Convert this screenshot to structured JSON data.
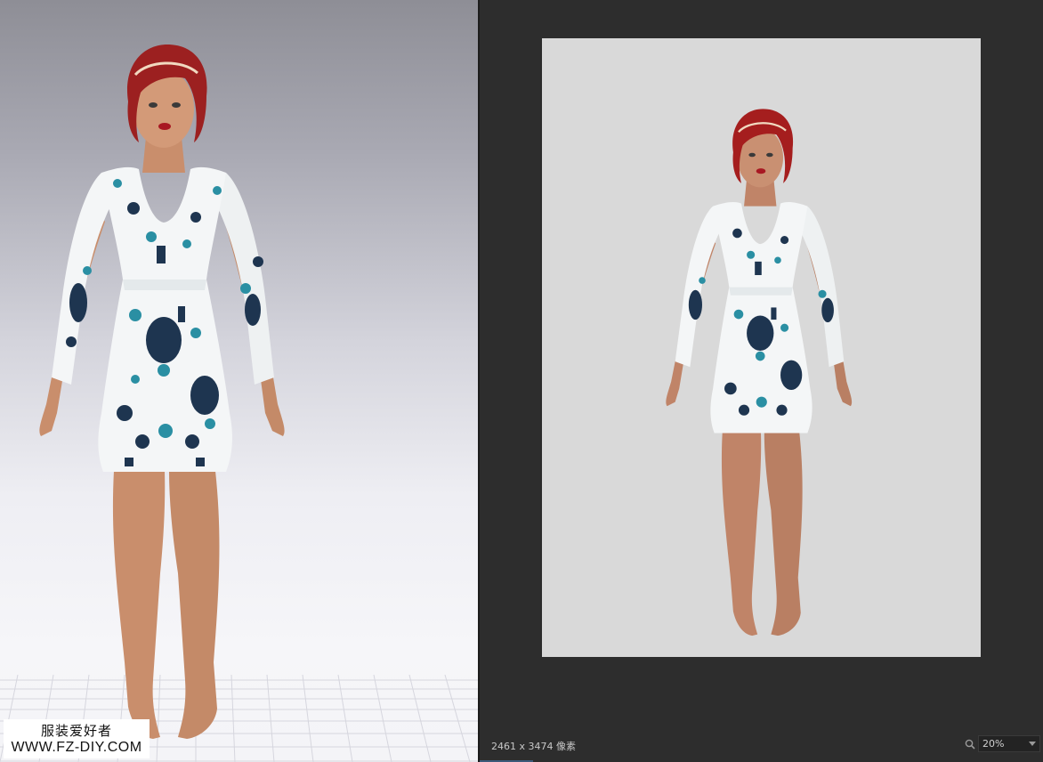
{
  "viewport": {
    "background_top": "#8e8e96",
    "background_bottom": "#f4f4f7"
  },
  "watermark": {
    "line1": "服装爱好者",
    "line2": "WWW.FZ-DIY.COM"
  },
  "preview": {
    "canvas_color": "#d9d9d9",
    "status": {
      "image_size": "2461 x 3474 像素",
      "zoom_icon": "zoom-magnifier-icon",
      "zoom_value": "20%"
    }
  },
  "colors": {
    "dress_base": "#f4f6f7",
    "print_teal": "#2a8fa3",
    "print_navy": "#1e3550",
    "hair": "#9c2020",
    "skin": "#c98e6c"
  }
}
